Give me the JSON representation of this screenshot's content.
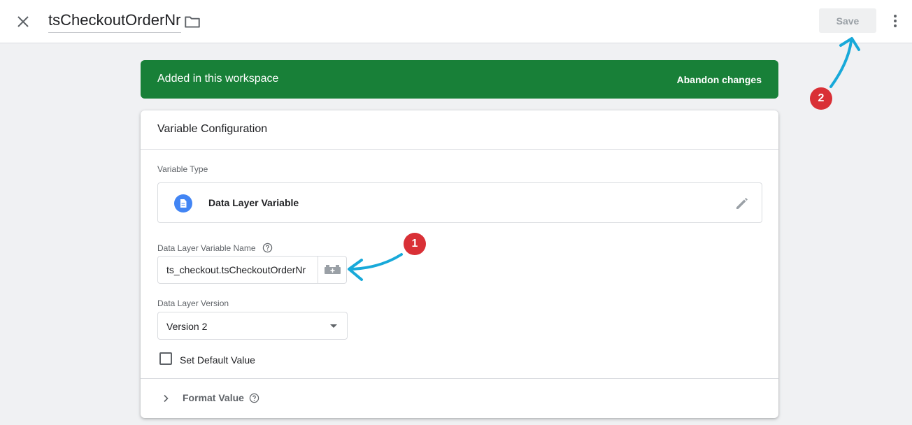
{
  "topbar": {
    "title": "tsCheckoutOrderNr",
    "save_label": "Save"
  },
  "banner": {
    "text": "Added in this workspace",
    "action": "Abandon changes",
    "color": "#188038"
  },
  "card": {
    "header": "Variable Configuration",
    "variable_type_label": "Variable Type",
    "variable_type_name": "Data Layer Variable",
    "name_label": "Data Layer Variable Name",
    "name_value": "ts_checkout.tsCheckoutOrderNr",
    "version_label": "Data Layer Version",
    "version_value": "Version 2",
    "default_value_label": "Set Default Value",
    "format_value_label": "Format Value"
  },
  "annotations": {
    "badge_1": "1",
    "badge_2": "2",
    "badge_color": "#d93036",
    "arrow_color": "#18a9d9"
  },
  "icons": {
    "close": "close-icon",
    "folder": "folder-icon",
    "more": "more-vert-icon",
    "doc": "document-icon",
    "edit": "pencil-icon",
    "help": "help-circle-icon",
    "variable": "variable-picker-icon",
    "caret": "caret-down-icon",
    "chevron": "chevron-right-icon"
  }
}
